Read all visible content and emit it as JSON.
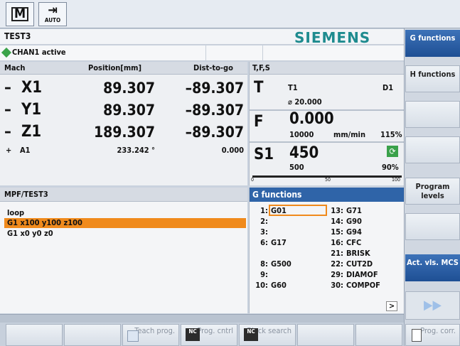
{
  "top": {
    "mode_machine": "M",
    "mode_auto": "AUTO"
  },
  "header": {
    "program_name": "TEST3",
    "brand": "SIEMENS",
    "channel_status": "CHAN1 active"
  },
  "positions": {
    "col_mach": "Mach",
    "col_position": "Position[mm]",
    "col_dist": "Dist-to-go",
    "axes": [
      {
        "sign": "–",
        "name": "X1",
        "position": "89.307",
        "dist": "–89.307"
      },
      {
        "sign": "–",
        "name": "Y1",
        "position": "89.307",
        "dist": "–89.307"
      },
      {
        "sign": "–",
        "name": "Z1",
        "position": "189.307",
        "dist": "–89.307"
      }
    ],
    "aux_axis": {
      "sign": "+",
      "name": "A1",
      "position": "233.242 °",
      "dist": "0.000"
    }
  },
  "tfs": {
    "title": "T,F,S",
    "t_label": "T",
    "tool": "T1",
    "d": "D1",
    "diameter": "⌀ 20.000",
    "f_label": "F",
    "feed": "0.000",
    "feed_prog": "10000",
    "feed_unit": "mm/min",
    "feed_override": "115%",
    "s_label": "S1",
    "speed": "450",
    "speed_prog": "500",
    "speed_override": "90%",
    "bar_ticks": [
      "0",
      "50",
      "100"
    ]
  },
  "program": {
    "title": "MPF/TEST3",
    "lines": [
      "loop",
      "G1 x100 y100 z100",
      "G1 x0 y0 z0"
    ]
  },
  "gfunctions": {
    "title": "G functions",
    "left": [
      {
        "num": "1:",
        "val": "G01"
      },
      {
        "num": "2:",
        "val": ""
      },
      {
        "num": "3:",
        "val": ""
      },
      {
        "num": "6:",
        "val": "G17"
      },
      {
        "num": "",
        "val": ""
      },
      {
        "num": "8:",
        "val": "G500"
      },
      {
        "num": "9:",
        "val": ""
      },
      {
        "num": "10:",
        "val": "G60"
      }
    ],
    "right": [
      {
        "num": "13:",
        "val": "G71"
      },
      {
        "num": "14:",
        "val": "G90"
      },
      {
        "num": "15:",
        "val": "G94"
      },
      {
        "num": "16:",
        "val": "CFC"
      },
      {
        "num": "21:",
        "val": "BRISK"
      },
      {
        "num": "22:",
        "val": "CUT2D"
      },
      {
        "num": "29:",
        "val": "DIAMOF"
      },
      {
        "num": "30:",
        "val": "COMPOF"
      }
    ],
    "more": ">"
  },
  "vertical_softkeys": {
    "g_functions": "G functions",
    "h_functions": "H functions",
    "program_levels": "Program levels",
    "act_vals": "Act. vls. MCS"
  },
  "horizontal_softkeys": {
    "teach_prog": "Teach prog.",
    "prog_cntrl": "Prog. cntrl",
    "block_search": "Block search",
    "prog_corr": "Prog. corr."
  },
  "colors": {
    "accent_blue": "#2f64a8",
    "highlight_orange": "#f08a1c",
    "brand_teal": "#1e8b8f",
    "active_green": "#3ba34a"
  }
}
